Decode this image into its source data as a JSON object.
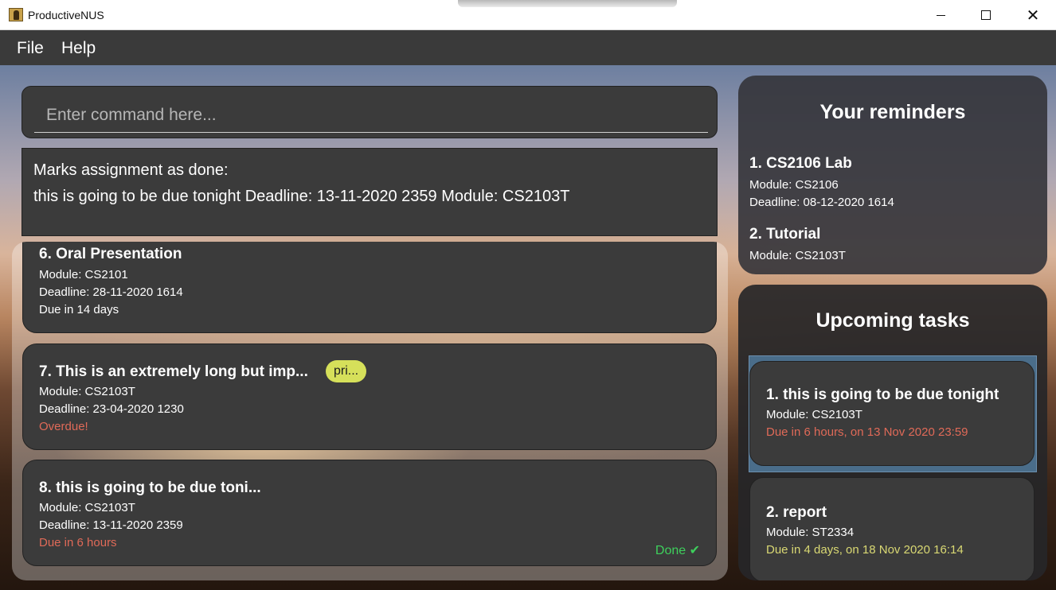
{
  "window": {
    "title": "ProductiveNUS"
  },
  "menu": {
    "file": "File",
    "help": "Help"
  },
  "command": {
    "placeholder": "Enter command here..."
  },
  "result": {
    "line1": "Marks assignment as done:",
    "line2": "this is going to be due tonight Deadline: 13-11-2020 2359 Module: CS2103T"
  },
  "tasks": [
    {
      "title": "6.  Oral Presentation",
      "module": "Module: CS2101",
      "deadline": "Deadline: 28-11-2020 1614",
      "status": "Due in 14 days"
    },
    {
      "title": "7.  This is an extremely long but imp...",
      "tag": "pri...",
      "module": "Module: CS2103T",
      "deadline": "Deadline: 23-04-2020 1230",
      "status": "Overdue!"
    },
    {
      "title": "8.  this is going to be due toni...",
      "module": "Module: CS2103T",
      "deadline": "Deadline: 13-11-2020 2359",
      "status": "Due in 6 hours",
      "done": "Done ✔"
    }
  ],
  "reminders": {
    "title": "Your reminders",
    "items": [
      {
        "title": "1.  CS2106 Lab",
        "module": "Module: CS2106",
        "deadline": "Deadline: 08-12-2020 1614"
      },
      {
        "title": "2.  Tutorial",
        "module": "Module: CS2103T"
      }
    ]
  },
  "upcoming": {
    "title": "Upcoming tasks",
    "items": [
      {
        "title": "1.  this is going to be due tonight",
        "module": "Module: CS2103T",
        "due": "Due in 6 hours, on 13 Nov 2020 23:59"
      },
      {
        "title": "2.  report",
        "module": "Module: ST2334",
        "due": "Due in 4 days, on 18 Nov 2020 16:14"
      }
    ]
  },
  "colors": {
    "panel": "#3b3b3b",
    "overdue_red": "#e06a58",
    "done_green": "#3ecf5c",
    "soon_yellow": "#d9d873",
    "tag_yellow": "#d6e05a",
    "selected_blue": "#4a6d8a"
  }
}
